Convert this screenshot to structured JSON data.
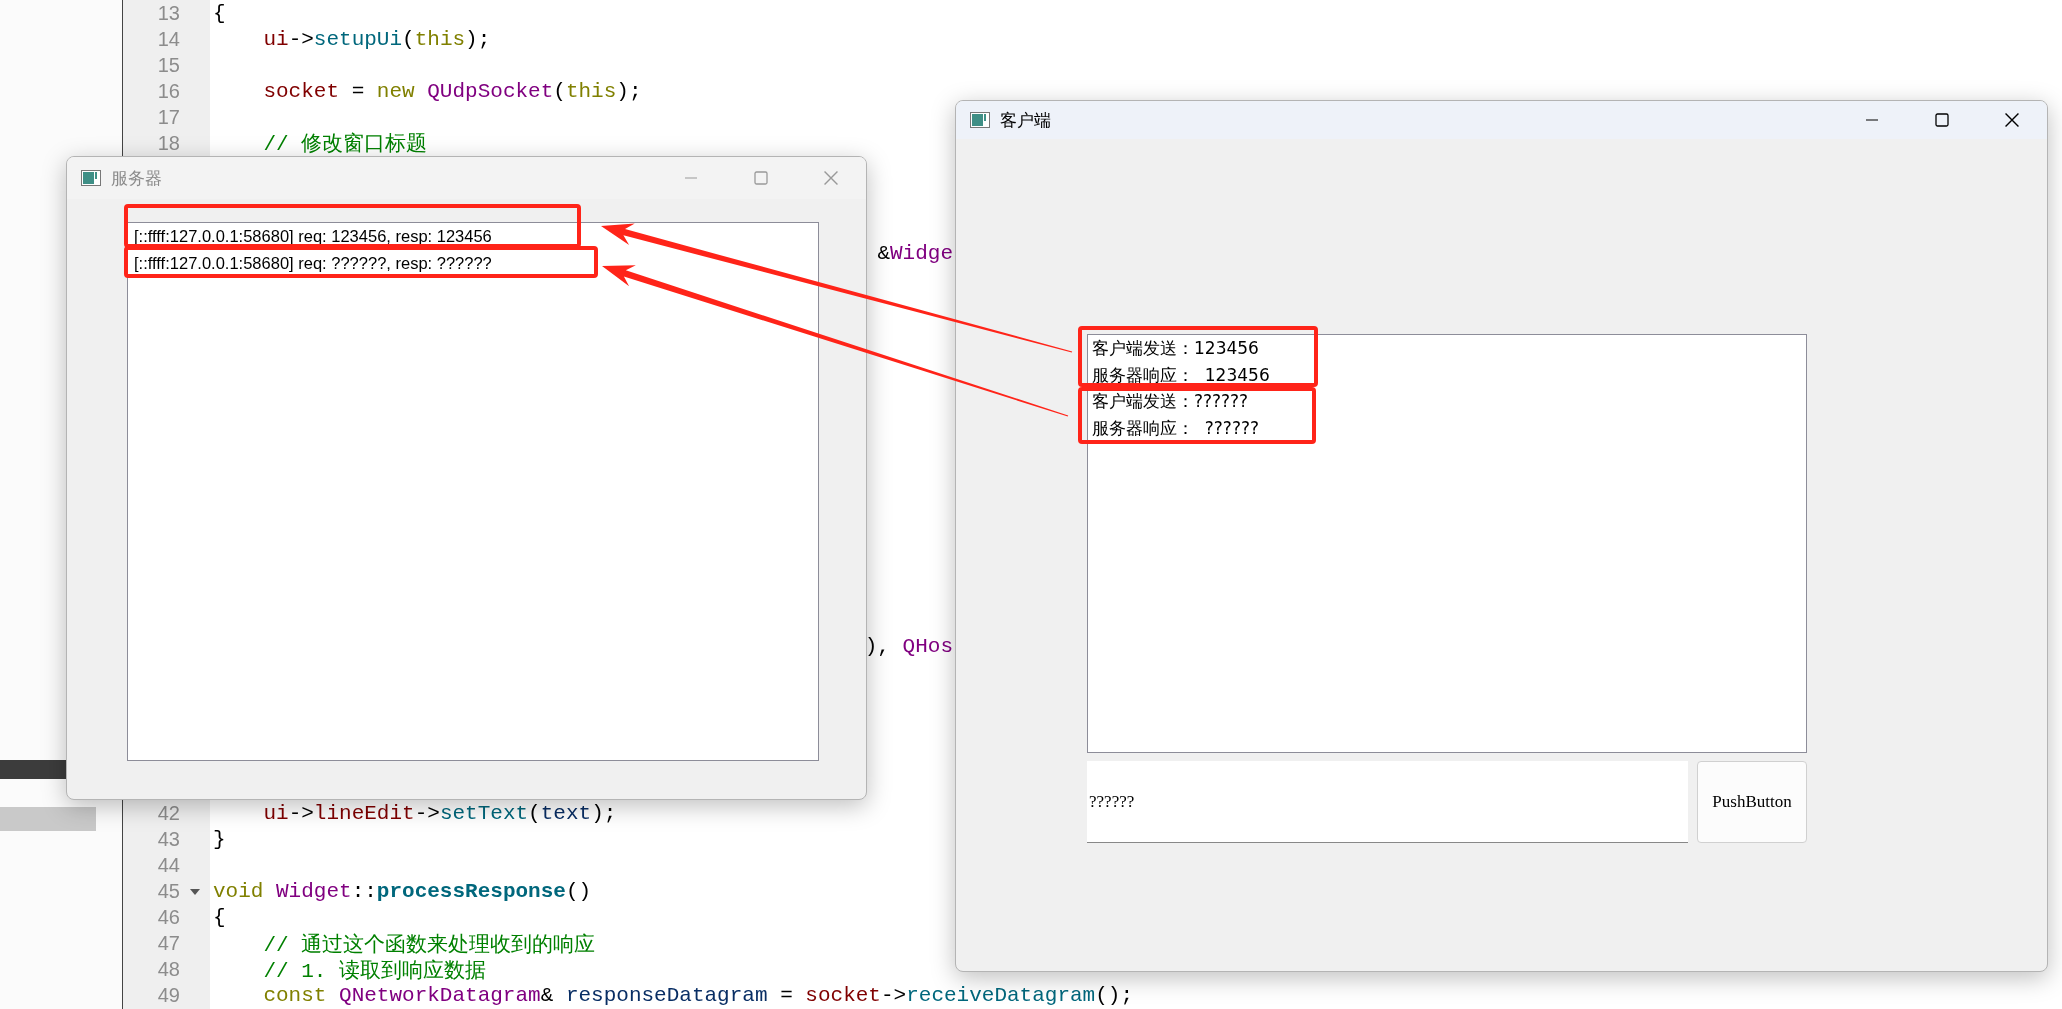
{
  "editor": {
    "lines": [
      {
        "kind": "code",
        "number": "13",
        "fold": false,
        "tokens": [
          {
            "text": "{",
            "color": "#000000"
          }
        ]
      },
      {
        "kind": "code",
        "number": "14",
        "fold": false,
        "tokens": [
          {
            "text": "    ui",
            "color": "#800000"
          },
          {
            "text": "->",
            "color": "#000000"
          },
          {
            "text": "setupUi",
            "color": "#00677c"
          },
          {
            "text": "(",
            "color": "#000000"
          },
          {
            "text": "this",
            "color": "#808000"
          },
          {
            "text": ");",
            "color": "#000000"
          }
        ]
      },
      {
        "kind": "blank",
        "number": "15",
        "fold": false
      },
      {
        "kind": "code",
        "number": "16",
        "fold": false,
        "tokens": [
          {
            "text": "    socket",
            "color": "#800000"
          },
          {
            "text": " = ",
            "color": "#000000"
          },
          {
            "text": "new ",
            "color": "#808000"
          },
          {
            "text": "QUdpSocket",
            "color": "#800080"
          },
          {
            "text": "(",
            "color": "#000000"
          },
          {
            "text": "this",
            "color": "#808000"
          },
          {
            "text": ");",
            "color": "#000000"
          }
        ]
      },
      {
        "kind": "blank",
        "number": "17",
        "fold": false
      },
      {
        "kind": "code",
        "number": "18",
        "fold": false,
        "tokens": [
          {
            "text": "    // 修改窗口标题",
            "color": "#008000"
          }
        ]
      },
      {
        "kind": "covered"
      },
      {
        "kind": "covered"
      },
      {
        "kind": "covered"
      },
      {
        "kind": "fragment",
        "tokens": [
          {
            "text": "&",
            "color": "#000000"
          },
          {
            "text": "Widge",
            "color": "#800080"
          }
        ]
      },
      {
        "kind": "covered"
      },
      {
        "kind": "covered"
      },
      {
        "kind": "covered"
      },
      {
        "kind": "covered"
      },
      {
        "kind": "covered"
      },
      {
        "kind": "covered"
      },
      {
        "kind": "covered"
      },
      {
        "kind": "covered"
      },
      {
        "kind": "covered"
      },
      {
        "kind": "covered"
      },
      {
        "kind": "covered"
      },
      {
        "kind": "covered"
      },
      {
        "kind": "covered"
      },
      {
        "kind": "fragment",
        "tokens": [
          {
            "text": "), ",
            "color": "#000000"
          },
          {
            "text": "QHos",
            "color": "#800080"
          }
        ]
      },
      {
        "kind": "covered"
      },
      {
        "kind": "covered"
      },
      {
        "kind": "covered"
      },
      {
        "kind": "covered"
      },
      {
        "kind": "covered"
      },
      {
        "kind": "code",
        "number": "42",
        "fold": false,
        "tokens": [
          {
            "text": "    ui",
            "color": "#800000"
          },
          {
            "text": "->",
            "color": "#000000"
          },
          {
            "text": "lineEdit",
            "color": "#800000"
          },
          {
            "text": "->",
            "color": "#000000"
          },
          {
            "text": "setText",
            "color": "#00677c"
          },
          {
            "text": "(",
            "color": "#000000"
          },
          {
            "text": "text",
            "color": "#092e64"
          },
          {
            "text": ");",
            "color": "#000000"
          }
        ]
      },
      {
        "kind": "code",
        "number": "43",
        "fold": false,
        "tokens": [
          {
            "text": "}",
            "color": "#000000"
          }
        ]
      },
      {
        "kind": "blank",
        "number": "44",
        "fold": false
      },
      {
        "kind": "code",
        "number": "45",
        "fold": true,
        "tokens": [
          {
            "text": "void ",
            "color": "#808000"
          },
          {
            "text": "Widget",
            "color": "#800080"
          },
          {
            "text": "::",
            "color": "#000000"
          },
          {
            "text": "**processResponse**",
            "color": "#00677c"
          },
          {
            "text": "()",
            "color": "#000000"
          }
        ]
      },
      {
        "kind": "code",
        "number": "46",
        "fold": false,
        "tokens": [
          {
            "text": "{",
            "color": "#000000"
          }
        ]
      },
      {
        "kind": "code",
        "number": "47",
        "fold": false,
        "tokens": [
          {
            "text": "    // 通过这个函数来处理收到的响应",
            "color": "#008000"
          }
        ]
      },
      {
        "kind": "code",
        "number": "48",
        "fold": false,
        "tokens": [
          {
            "text": "    // 1. 读取到响应数据",
            "color": "#008000"
          }
        ]
      },
      {
        "kind": "code",
        "number": "49",
        "fold": false,
        "tokens": [
          {
            "text": "    const ",
            "color": "#808000"
          },
          {
            "text": "QNetworkDatagram",
            "color": "#800080"
          },
          {
            "text": "& ",
            "color": "#000000"
          },
          {
            "text": "responseDatagram",
            "color": "#092e64"
          },
          {
            "text": " = ",
            "color": "#000000"
          },
          {
            "text": "socket",
            "color": "#800000"
          },
          {
            "text": "->",
            "color": "#000000"
          },
          {
            "text": "receiveDatagram",
            "color": "#00677c"
          },
          {
            "text": "();",
            "color": "#000000"
          }
        ]
      }
    ]
  },
  "server_window": {
    "title": "服务器",
    "active": false,
    "log": [
      "[::ffff:127.0.0.1:58680] req: 123456, resp: 123456",
      "[::ffff:127.0.0.1:58680] req: ??????, resp: ??????"
    ]
  },
  "client_window": {
    "title": "客户端",
    "active": true,
    "log": [
      "客户端发送：123456",
      "服务器响应：  123456",
      "客户端发送：??????",
      "服务器响应：  ??????"
    ],
    "input": {
      "value": "??????"
    },
    "button": "PushButton"
  }
}
